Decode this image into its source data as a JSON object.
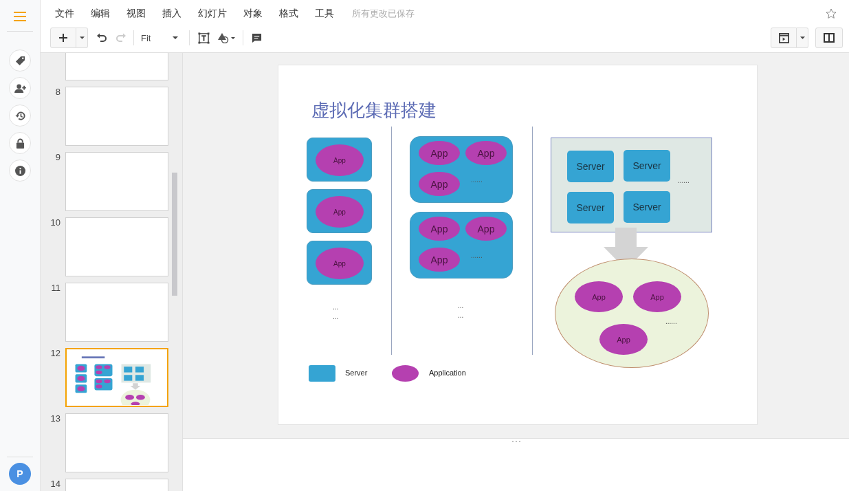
{
  "menu": [
    {
      "label": "文件"
    },
    {
      "label": "编辑"
    },
    {
      "label": "视图"
    },
    {
      "label": "插入"
    },
    {
      "label": "幻灯片"
    },
    {
      "label": "对象"
    },
    {
      "label": "格式"
    },
    {
      "label": "工具"
    }
  ],
  "save_status": "所有更改已保存",
  "toolbar": {
    "zoom": "Fit",
    "undo_disabled": false,
    "redo_disabled": true
  },
  "user": {
    "initial": "P"
  },
  "slides": [
    {
      "kind": "blank",
      "selected": false
    },
    {
      "number": "8",
      "kind": "blank",
      "selected": false
    },
    {
      "number": "9",
      "kind": "blank",
      "selected": false
    },
    {
      "number": "10",
      "kind": "blank",
      "selected": false
    },
    {
      "number": "11",
      "kind": "blank",
      "selected": false
    },
    {
      "number": "12",
      "kind": "diagram",
      "selected": true
    },
    {
      "number": "13",
      "kind": "blank",
      "selected": false
    },
    {
      "number": "14",
      "kind": "blank",
      "selected": false
    }
  ],
  "slide": {
    "title": "虚拟化集群搭建",
    "left_hosts": [
      {
        "apps": [
          "App"
        ]
      },
      {
        "apps": [
          "App"
        ]
      },
      {
        "apps": [
          "App"
        ]
      }
    ],
    "left_more": [
      "...",
      "..."
    ],
    "middle_hosts": [
      {
        "apps": [
          "App",
          "App",
          "App"
        ],
        "more": "......"
      },
      {
        "apps": [
          "App",
          "App",
          "App"
        ],
        "more": "......"
      }
    ],
    "middle_more": [
      "...",
      "..."
    ],
    "pool": {
      "servers": [
        "Server",
        "Server",
        "Server",
        "Server"
      ],
      "more": "......"
    },
    "cluster": {
      "apps": [
        "App",
        "App",
        "App"
      ],
      "more": "......"
    },
    "legend": [
      {
        "kind": "server",
        "label": "Server"
      },
      {
        "kind": "application",
        "label": "Application"
      }
    ]
  }
}
